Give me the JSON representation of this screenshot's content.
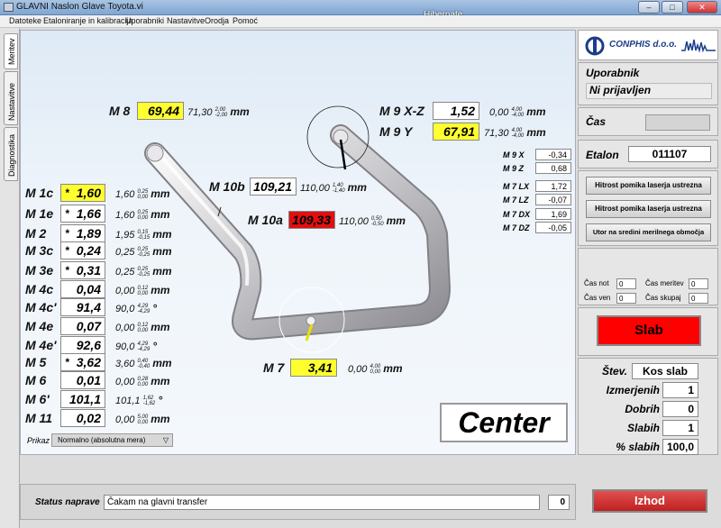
{
  "window": {
    "title": "GLAVNI Naslon Glave Toyota.vi",
    "overlay": "Hibernate"
  },
  "menu": [
    "Datoteke",
    "Etaloniranje in kalibracija",
    "Uporabniki",
    "Nastavitve",
    "Orodja",
    "Pomoć"
  ],
  "tabs": [
    "Meritev",
    "Nastavitve",
    "Diagnostika"
  ],
  "measurements": [
    {
      "label": "M 1c",
      "star": "*",
      "value": "1,60",
      "nominal": "1,60",
      "tol_up": "0,25",
      "tol_lo": "0,00",
      "unit": "mm",
      "highlight": "yellow"
    },
    {
      "label": "M 1e",
      "star": "*",
      "value": "1,66",
      "nominal": "1,60",
      "tol_up": "0,25",
      "tol_lo": "0,00",
      "unit": "mm",
      "highlight": "none"
    },
    {
      "label": "M 2",
      "star": "*",
      "value": "1,89",
      "nominal": "1,95",
      "tol_up": "0,15",
      "tol_lo": "-0,15",
      "unit": "mm",
      "highlight": "none"
    },
    {
      "label": "M 3c",
      "star": "*",
      "value": "0,24",
      "nominal": "0,25",
      "tol_up": "0,25",
      "tol_lo": "-0,25",
      "unit": "mm",
      "highlight": "none"
    },
    {
      "label": "M 3e",
      "star": "*",
      "value": "0,31",
      "nominal": "0,25",
      "tol_up": "0,25",
      "tol_lo": "-0,25",
      "unit": "mm",
      "highlight": "none"
    },
    {
      "label": "M 4c",
      "star": "",
      "value": "0,04",
      "nominal": "0,00",
      "tol_up": "0,12",
      "tol_lo": "0,00",
      "unit": "mm",
      "highlight": "none"
    },
    {
      "label": "M 4c'",
      "star": "",
      "value": "91,4",
      "nominal": "90,0",
      "tol_up": "4,29",
      "tol_lo": "-4,29",
      "unit": "°",
      "highlight": "none"
    },
    {
      "label": "M 4e",
      "star": "",
      "value": "0,07",
      "nominal": "0,00",
      "tol_up": "0,12",
      "tol_lo": "0,00",
      "unit": "mm",
      "highlight": "none"
    },
    {
      "label": "M 4e'",
      "star": "",
      "value": "92,6",
      "nominal": "90,0",
      "tol_up": "4,29",
      "tol_lo": "-4,29",
      "unit": "°",
      "highlight": "none"
    },
    {
      "label": "M 5",
      "star": "*",
      "value": "3,62",
      "nominal": "3,60",
      "tol_up": "0,40",
      "tol_lo": "-0,40",
      "unit": "mm",
      "highlight": "none"
    },
    {
      "label": "M 6",
      "star": "",
      "value": "0,01",
      "nominal": "0,00",
      "tol_up": "0,28",
      "tol_lo": "0,00",
      "unit": "mm",
      "highlight": "none"
    },
    {
      "label": "M 6'",
      "star": "",
      "value": "101,1",
      "nominal": "101,1",
      "tol_up": "1,62",
      "tol_lo": "-1,62",
      "unit": "°",
      "highlight": "none"
    },
    {
      "label": "M 11",
      "star": "",
      "value": "0,02",
      "nominal": "0,00",
      "tol_up": "5,00",
      "tol_lo": "0,00",
      "unit": "mm",
      "highlight": "none"
    }
  ],
  "m8": {
    "label": "M 8",
    "value": "69,44",
    "nominal": "71,30",
    "tol_up": "2,00",
    "tol_lo": "-2,00",
    "unit": "mm"
  },
  "m9xz": {
    "label": "M 9 X-Z",
    "value": "1,52",
    "nominal": "0,00",
    "tol_up": "4,00",
    "tol_lo": "-4,00",
    "unit": "mm"
  },
  "m9y": {
    "label": "M 9 Y",
    "value": "67,91",
    "nominal": "71,30",
    "tol_up": "4,00",
    "tol_lo": "-4,00",
    "unit": "mm"
  },
  "m10b": {
    "label": "M 10b",
    "value": "109,21",
    "nominal": "110,00",
    "tol_up": "1,40",
    "tol_lo": "-1,40",
    "unit": "mm"
  },
  "m10a": {
    "label": "M 10a",
    "value": "109,33",
    "nominal": "110,00",
    "tol_up": "0,50",
    "tol_lo": "-0,50",
    "unit": "mm"
  },
  "m7": {
    "label": "M 7",
    "value": "3,41",
    "nominal": "0,00",
    "tol_up": "4,00",
    "tol_lo": "0,00",
    "unit": "mm"
  },
  "aux": [
    {
      "label": "M 9 X",
      "value": "-0,34"
    },
    {
      "label": "M 9 Z",
      "value": "0,68"
    },
    {
      "label": "M 7 LX",
      "value": "1,72"
    },
    {
      "label": "M 7 LZ",
      "value": "-0,07"
    },
    {
      "label": "M 7 DX",
      "value": "1,69"
    },
    {
      "label": "M 7 DZ",
      "value": "-0,05"
    }
  ],
  "prikaz": {
    "label": "Prikaz",
    "value": "Normalno (absolutna mera)"
  },
  "center": "Center",
  "logo": "CONPHIS d.o.o.",
  "user": {
    "label": "Uporabnik",
    "value": "Ni prijavljen"
  },
  "cas": {
    "label": "Čas",
    "value": ""
  },
  "etalon": {
    "label": "Etalon",
    "value": "011107"
  },
  "buttons": [
    "Hitrost pomika laserja ustrezna",
    "Hitrost pomika laserja ustrezna",
    "Utor na sredini merilnega območja"
  ],
  "timers": [
    {
      "label": "Čas not",
      "value": "0"
    },
    {
      "label": "Čas meritev",
      "value": "0"
    },
    {
      "label": "Čas ven",
      "value": "0"
    },
    {
      "label": "Čas skupaj",
      "value": "0"
    }
  ],
  "result": {
    "text": "Slab",
    "color": "#ff0000"
  },
  "stats": {
    "stev": {
      "label": "Štev.",
      "value": "Kos slab"
    },
    "izmerjenih": {
      "label": "Izmerjenih",
      "value": "1"
    },
    "dobrih": {
      "label": "Dobrih",
      "value": "0"
    },
    "slabih": {
      "label": "Slabih",
      "value": "1"
    },
    "pct": {
      "label": "% slabih",
      "value": "100,0"
    }
  },
  "status": {
    "label": "Status naprave",
    "value": "Čakam na glavni transfer",
    "count": "0"
  },
  "exit": "Izhod"
}
